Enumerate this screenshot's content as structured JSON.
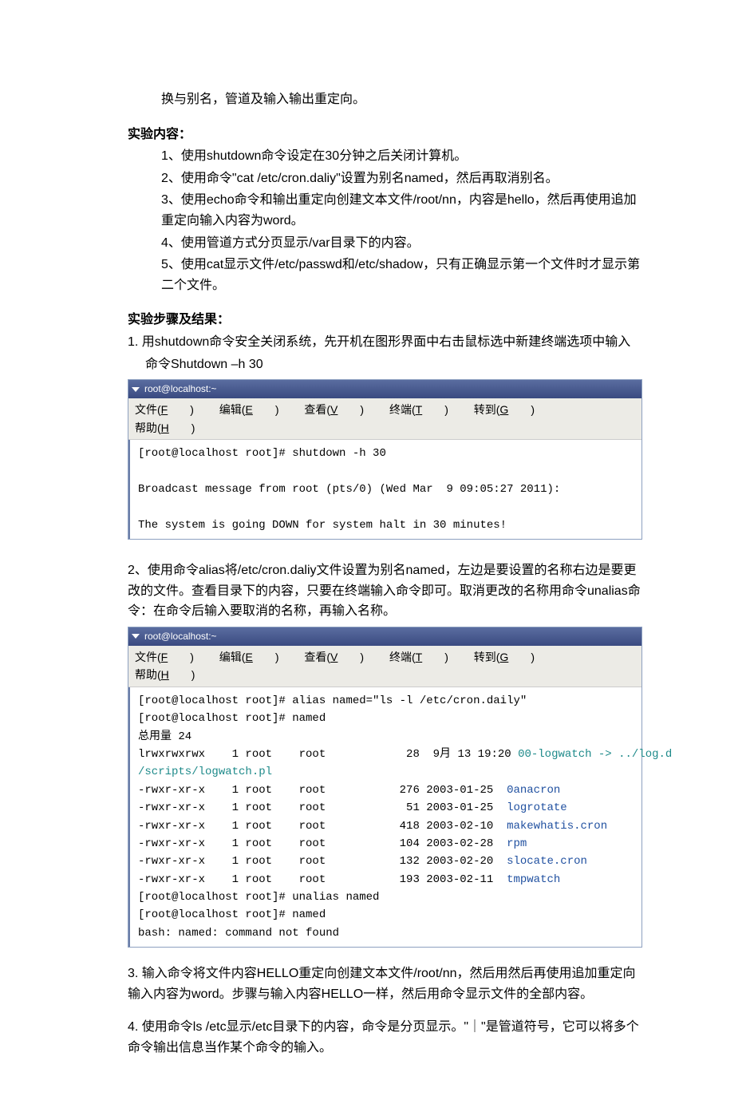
{
  "intro_line": "换与别名，管道及输入输出重定向。",
  "section_content_heading": "实验内容：",
  "content_items": [
    "1、使用shutdown命令设定在30分钟之后关闭计算机。",
    "2、使用命令\"cat /etc/cron.daliy\"设置为别名named，然后再取消别名。",
    "3、使用echo命令和输出重定向创建文本文件/root/nn，内容是hello，然后再使用追加重定向输入内容为word。",
    "4、使用管道方式分页显示/var目录下的内容。",
    "5、使用cat显示文件/etc/passwd和/etc/shadow，只有正确显示第一个文件时才显示第二个文件。"
  ],
  "section_steps_heading": "实验步骤及结果：",
  "step1_line1": "1.  用shutdown命令安全关闭系统，先开机在图形界面中右击鼠标选中新建终端选项中输入",
  "step1_line2": "命令Shutdown  –h   30",
  "terminal1": {
    "title": "root@localhost:~",
    "menu": [
      "文件(F)",
      "编辑(E)",
      "查看(V)",
      "终端(T)",
      "转到(G)",
      "帮助(H)"
    ],
    "body_lines": [
      "[root@localhost root]# shutdown -h 30",
      "",
      "Broadcast message from root (pts/0) (Wed Mar  9 09:05:27 2011):",
      "",
      "The system is going DOWN for system halt in 30 minutes!"
    ]
  },
  "step2_text": "2、使用命令alias将/etc/cron.daliy文件设置为别名named，左边是要设置的名称右边是要更改的文件。查看目录下的内容，只要在终端输入命令即可。取消更改的名称用命令unalias命令：在命令后输入要取消的名称，再输入名称。",
  "terminal2": {
    "title": "root@localhost:~",
    "menu": [
      "文件(F)",
      "编辑(E)",
      "查看(V)",
      "终端(T)",
      "转到(G)",
      "帮助(H)"
    ],
    "body_pre": [
      "[root@localhost root]# alias named=\"ls -l /etc/cron.daily\"",
      "[root@localhost root]# named",
      "总用量 24"
    ],
    "body_link_row": {
      "prefix": "lrwxrwxrwx    1 root    root            28  9月 13 19:20 ",
      "linkname": "00-logwatch -> ../log.d",
      "second": "/scripts/logwatch.pl"
    },
    "body_rows": [
      {
        "left": "-rwxr-xr-x    1 root    root           276 2003-01-25  ",
        "name": "0anacron"
      },
      {
        "left": "-rwxr-xr-x    1 root    root            51 2003-01-25  ",
        "name": "logrotate"
      },
      {
        "left": "-rwxr-xr-x    1 root    root           418 2003-02-10  ",
        "name": "makewhatis.cron"
      },
      {
        "left": "-rwxr-xr-x    1 root    root           104 2003-02-28  ",
        "name": "rpm"
      },
      {
        "left": "-rwxr-xr-x    1 root    root           132 2003-02-20  ",
        "name": "slocate.cron"
      },
      {
        "left": "-rwxr-xr-x    1 root    root           193 2003-02-11  ",
        "name": "tmpwatch"
      }
    ],
    "body_post": [
      "[root@localhost root]# unalias named",
      "[root@localhost root]# named",
      "bash: named: command not found"
    ]
  },
  "step3_text": "3. 输入命令将文件内容HELLO重定向创建文本文件/root/nn，然后用然后再使用追加重定向输入内容为word。步骤与输入内容HELLO一样，然后用命令显示文件的全部内容。",
  "step4_text": "4. 使用命令ls /etc显示/etc目录下的内容，命令是分页显示。\"｜\"是管道符号，它可以将多个命令输出信息当作某个命令的输入。"
}
